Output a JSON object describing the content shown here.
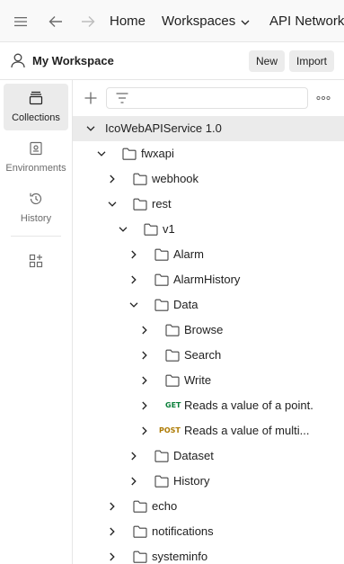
{
  "topbar": {
    "menu_icon": "hamburger-icon",
    "back_icon": "arrow-left-icon",
    "forward_icon": "arrow-right-icon",
    "home_label": "Home",
    "workspaces_label": "Workspaces",
    "api_network_label": "API Network"
  },
  "workspace": {
    "title": "My Workspace",
    "new_label": "New",
    "import_label": "Import"
  },
  "rail": {
    "collections_label": "Collections",
    "environments_label": "Environments",
    "history_label": "History"
  },
  "tree": {
    "root": "IcoWebAPIService 1.0",
    "fwxapi": "fwxapi",
    "webhook": "webhook",
    "rest": "rest",
    "v1": "v1",
    "alarm": "Alarm",
    "alarmhistory": "AlarmHistory",
    "data": "Data",
    "browse": "Browse",
    "search": "Search",
    "write": "Write",
    "get_method": "GET",
    "get_request": "Reads a value of a point.",
    "post_method": "POST",
    "post_request": "Reads a value of multi...",
    "dataset": "Dataset",
    "history": "History",
    "echo": "echo",
    "notifications": "notifications",
    "systeminfo": "systeminfo"
  },
  "colors": {
    "get": "#0b7f3a",
    "post": "#ad7a03",
    "selected_row": "#ebebeb"
  }
}
